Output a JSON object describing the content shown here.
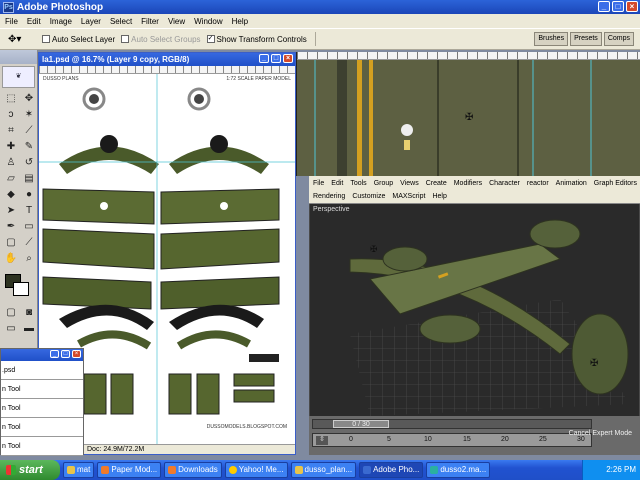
{
  "photoshop": {
    "title": "Adobe Photoshop",
    "menu": [
      "File",
      "Edit",
      "Image",
      "Layer",
      "Select",
      "Filter",
      "View",
      "Window",
      "Help"
    ],
    "options": {
      "auto_select_layer": "Auto Select Layer",
      "auto_select_groups": "Auto Select Groups",
      "show_transform_controls": "Show Transform Controls"
    },
    "palette_well": [
      "Brushes",
      "Presets",
      "Comps"
    ]
  },
  "document": {
    "title": "la1.psd @ 16.7% (Layer 9 copy, RGB/8)",
    "status": "Doc: 24.9M/72.2M",
    "sheet_header_left": "DUSSO PLANS",
    "sheet_header_right": "1:72 SCALE PAPER MODEL",
    "sheet_footer": "DUSSOMODELS.BLOGSPOT.COM"
  },
  "layers_palette": {
    "rows": [
      ".psd",
      "n Tool",
      "n Tool",
      "n Tool",
      "n Tool"
    ]
  },
  "max": {
    "menu": [
      "File",
      "Edit",
      "Tools",
      "Group",
      "Views",
      "Create",
      "Modifiers",
      "Character",
      "reactor",
      "Animation",
      "Graph Editors"
    ],
    "menu2": [
      "Rendering",
      "Customize",
      "MAXScript",
      "Help"
    ],
    "viewport_label": "Perspective",
    "time_slider": "0 / 30",
    "track_ticks": [
      "0",
      "5",
      "10",
      "15",
      "20",
      "25",
      "30"
    ],
    "cancel_label": "Cancel Expert Mode"
  },
  "taskbar": {
    "start": "start",
    "buttons": [
      {
        "label": "mat",
        "color": "#e8c44a"
      },
      {
        "label": "Paper Mod...",
        "color": "#f07a2a"
      },
      {
        "label": "Downloads",
        "color": "#f07a2a"
      },
      {
        "label": "Yahoo! Me...",
        "color": "#ffcc00"
      },
      {
        "label": "dusso_plan...",
        "color": "#e8c44a"
      },
      {
        "label": "Adobe Pho...",
        "color": "#3a6ad0"
      },
      {
        "label": "dusso2.ma...",
        "color": "#2ab0a0"
      }
    ],
    "clock": "2:26 PM"
  }
}
